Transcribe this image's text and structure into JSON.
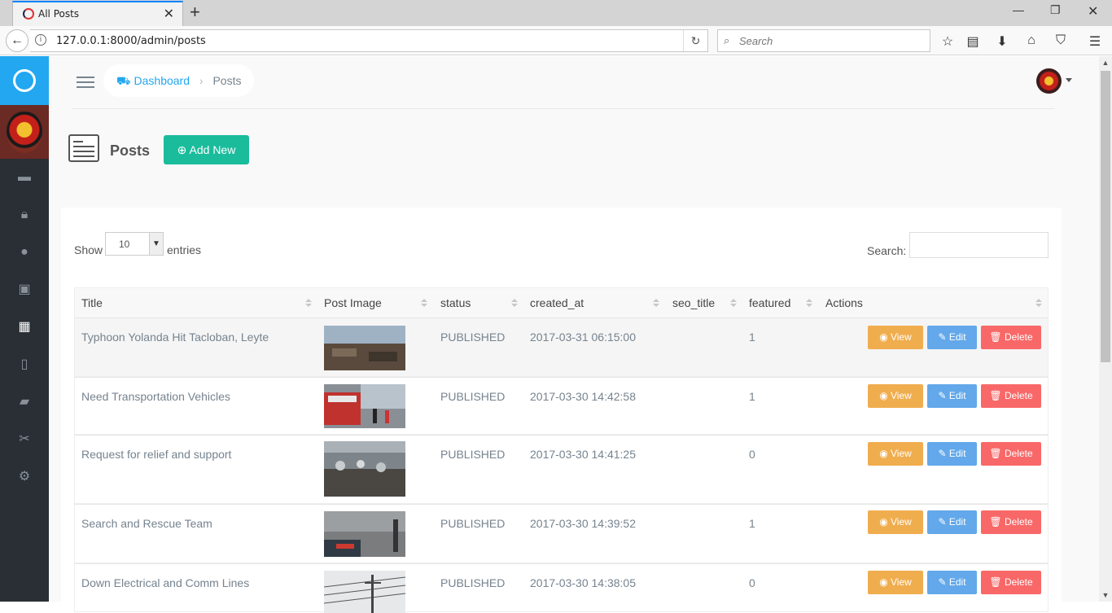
{
  "browser": {
    "tab_title": "All Posts",
    "url": "127.0.0.1:8000/admin/posts",
    "search_placeholder": "Search"
  },
  "header": {
    "breadcrumb_home": "Dashboard",
    "breadcrumb_current": "Posts"
  },
  "page": {
    "title": "Posts",
    "add_new_label": "Add New"
  },
  "table_controls": {
    "show_label": "Show",
    "entries_value": "10",
    "entries_label": "entries",
    "search_label": "Search:"
  },
  "columns": [
    "Title",
    "Post Image",
    "status",
    "created_at",
    "seo_title",
    "featured",
    "Actions"
  ],
  "buttons": {
    "view": "View",
    "edit": "Edit",
    "delete": "Delete"
  },
  "rows": [
    {
      "title": "Typhoon Yolanda Hit Tacloban, Leyte",
      "status": "PUBLISHED",
      "created_at": "2017-03-31 06:15:00",
      "seo_title": "",
      "featured": "1"
    },
    {
      "title": "Need Transportation Vehicles",
      "status": "PUBLISHED",
      "created_at": "2017-03-30 14:42:58",
      "seo_title": "",
      "featured": "1"
    },
    {
      "title": "Request for relief and support",
      "status": "PUBLISHED",
      "created_at": "2017-03-30 14:41:25",
      "seo_title": "",
      "featured": "0"
    },
    {
      "title": "Search and Rescue Team",
      "status": "PUBLISHED",
      "created_at": "2017-03-30 14:39:52",
      "seo_title": "",
      "featured": "1"
    },
    {
      "title": "Down Electrical and Comm Lines",
      "status": "PUBLISHED",
      "created_at": "2017-03-30 14:38:05",
      "seo_title": "",
      "featured": "0"
    }
  ],
  "colors": {
    "accent": "#22a7f0",
    "add_button": "#1abc9c",
    "view": "#f0ad4e",
    "edit": "#62a8ea",
    "delete": "#f96868",
    "sidebar": "#2a2f35"
  }
}
